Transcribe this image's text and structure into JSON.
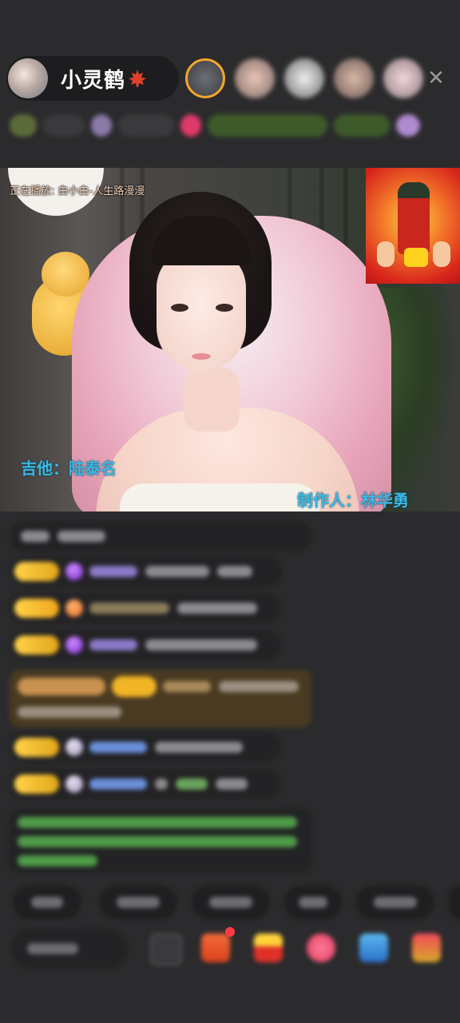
{
  "host": {
    "name": "小灵鹤",
    "name_icon": "maple-leaf-icon"
  },
  "top_bar": {
    "viewer_avatars_count": 5,
    "close_icon": "close-icon",
    "close_glyph": "✕"
  },
  "stream": {
    "now_playing": "正在播放: 白小白-人生路漫漫",
    "credits": {
      "guitar": "吉他：陆泰名",
      "producer": "制作人：林华勇"
    }
  },
  "chat": {
    "entries": 8
  },
  "bottom_bar": {
    "icons": [
      "emoji-icon",
      "gift-box-icon",
      "fries-icon",
      "heart-gift-icon",
      "photo-icon",
      "red-packet-icon"
    ]
  },
  "colors": {
    "background": "#2b2b2d",
    "credit_text": "#3ab9e4",
    "badge_gold": "#f2b526",
    "accent_orange": "#f4a52d"
  }
}
